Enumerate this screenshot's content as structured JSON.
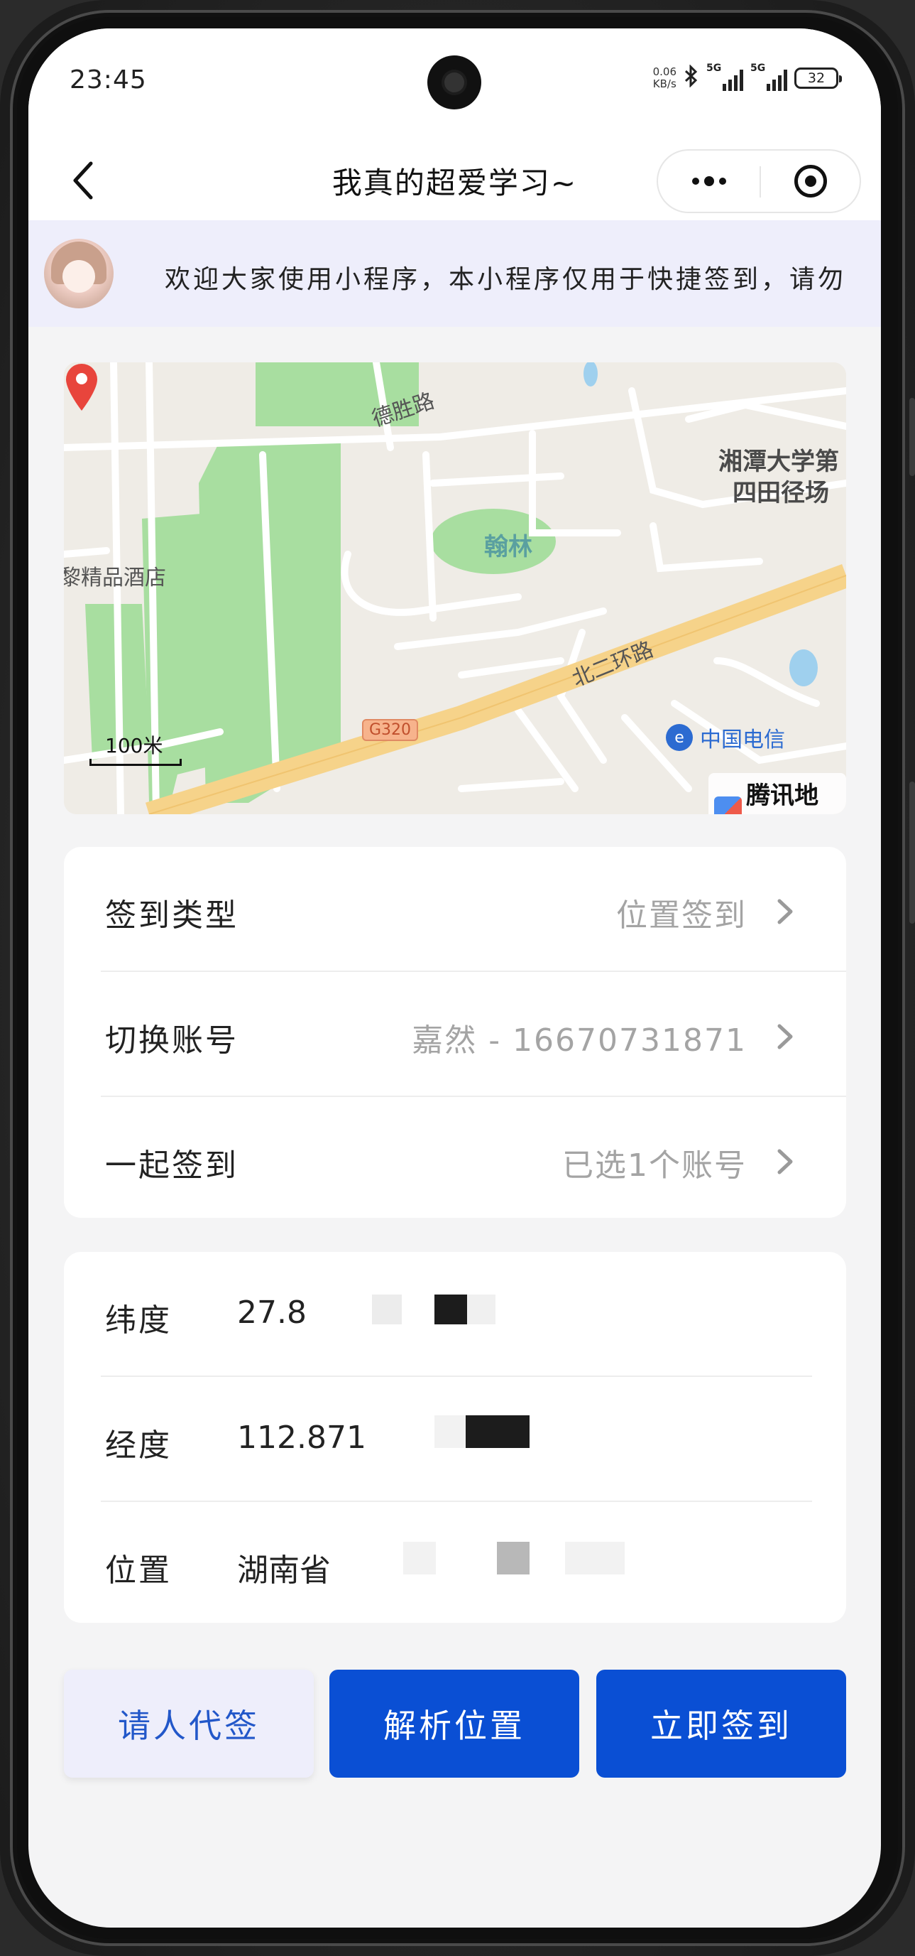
{
  "status_bar": {
    "time": "23:45",
    "net_speed_value": "0.06",
    "net_speed_unit": "KB/s",
    "signal1_label": "5G",
    "signal2_label": "5G",
    "battery": "32"
  },
  "nav": {
    "title": "我真的超爱学习~"
  },
  "notice": {
    "text": "欢迎大家使用小程序，本小程序仅用于快捷签到，请勿"
  },
  "map": {
    "labels": {
      "road_desheng": "德胜路",
      "university": "湘潭大学第",
      "field": "四田径场",
      "hotel": "黎精品酒店",
      "hanlin": "翰林",
      "ring_road": "北二环路",
      "highway_badge": "G320",
      "telecom": "中国电信",
      "scale": "100米",
      "provider": "腾讯地图"
    }
  },
  "settings": {
    "rows": [
      {
        "label": "签到类型",
        "value": "位置签到"
      },
      {
        "label": "切换账号",
        "value": "嘉然 - 16670731871"
      },
      {
        "label": "一起签到",
        "value": "已选1个账号"
      }
    ]
  },
  "location": {
    "rows": [
      {
        "label": "纬度",
        "value": "27.8"
      },
      {
        "label": "经度",
        "value": "112.871"
      },
      {
        "label": "位置",
        "value": "湖南省"
      }
    ]
  },
  "buttons": {
    "proxy": "请人代签",
    "parse": "解析位置",
    "sign": "立即签到"
  }
}
